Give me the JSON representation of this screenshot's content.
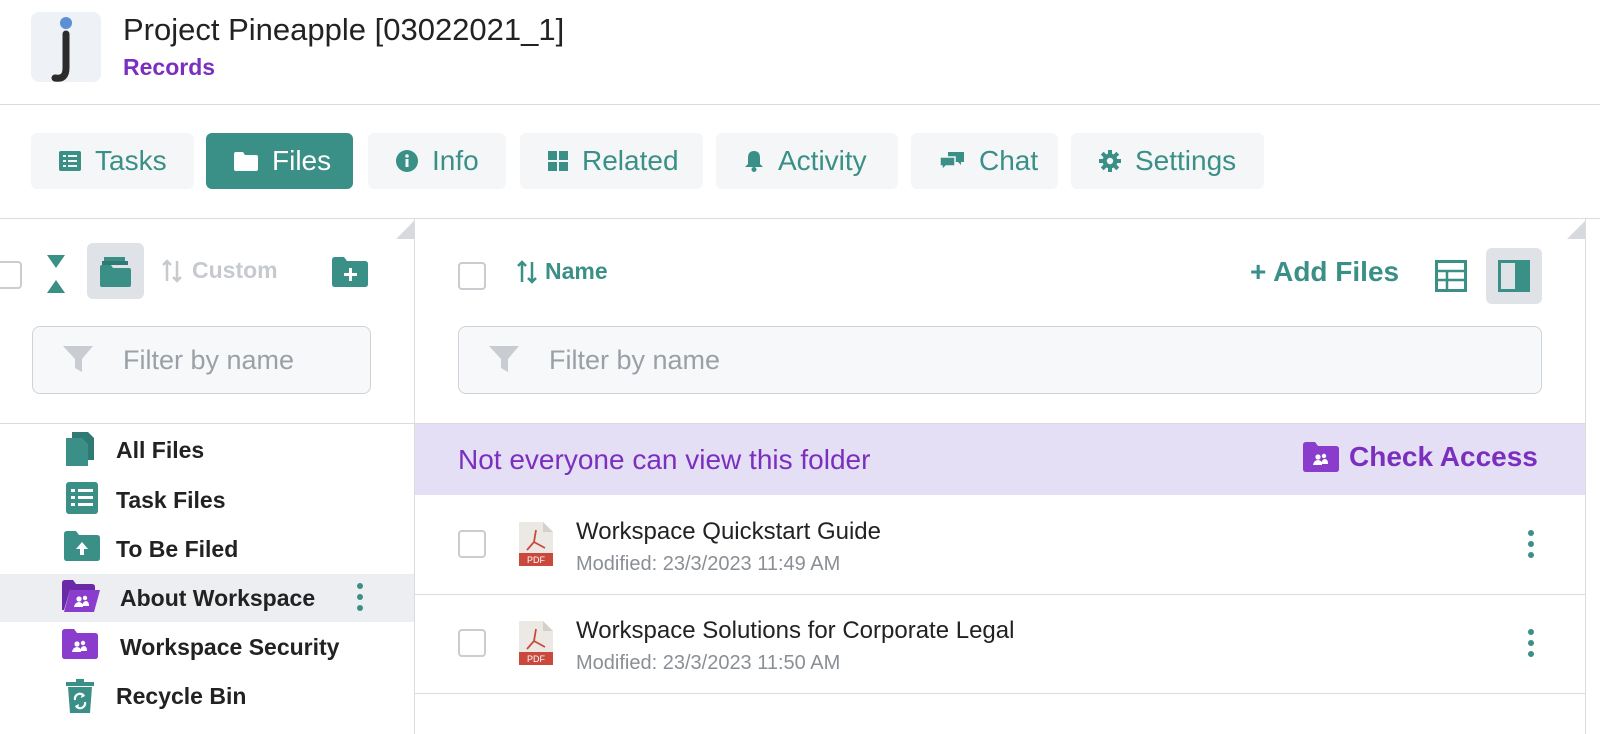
{
  "header": {
    "logo_letter": "j",
    "title": "Project Pineapple [03022021_1]",
    "subtitle": "Records"
  },
  "tabs": [
    {
      "label": "Tasks",
      "icon": "list-icon"
    },
    {
      "label": "Files",
      "icon": "folder-icon",
      "active": true
    },
    {
      "label": "Info",
      "icon": "info-icon"
    },
    {
      "label": "Related",
      "icon": "grid-icon"
    },
    {
      "label": "Activity",
      "icon": "bell-icon"
    },
    {
      "label": "Chat",
      "icon": "chat-icon"
    },
    {
      "label": "Settings",
      "icon": "gear-icon"
    }
  ],
  "left_panel": {
    "sort_label": "Custom",
    "filter_placeholder": "Filter by name",
    "tree": [
      {
        "label": "All Files",
        "icon": "file-icon"
      },
      {
        "label": "Task Files",
        "icon": "list-icon"
      },
      {
        "label": "To Be Filed",
        "icon": "folder-upload-icon"
      },
      {
        "label": "About Workspace",
        "icon": "shared-folder-open-icon",
        "selected": true
      },
      {
        "label": "Workspace Security",
        "icon": "shared-folder-icon"
      },
      {
        "label": "Recycle Bin",
        "icon": "recycle-bin-icon"
      }
    ]
  },
  "right_panel": {
    "sort_label": "Name",
    "add_files_label": "+ Add Files",
    "filter_placeholder": "Filter by name",
    "banner_text": "Not everyone can view this folder",
    "check_access_label": "Check Access",
    "files": [
      {
        "name": "Workspace Quickstart Guide",
        "modified": "Modified: 23/3/2023 11:49 AM",
        "type": "PDF"
      },
      {
        "name": "Workspace Solutions for Corporate Legal",
        "modified": "Modified: 23/3/2023 11:50 AM",
        "type": "PDF"
      }
    ]
  },
  "colors": {
    "accent": "#3a8f86",
    "purple": "#7a2fbf",
    "banner_bg": "#e5dff5"
  }
}
